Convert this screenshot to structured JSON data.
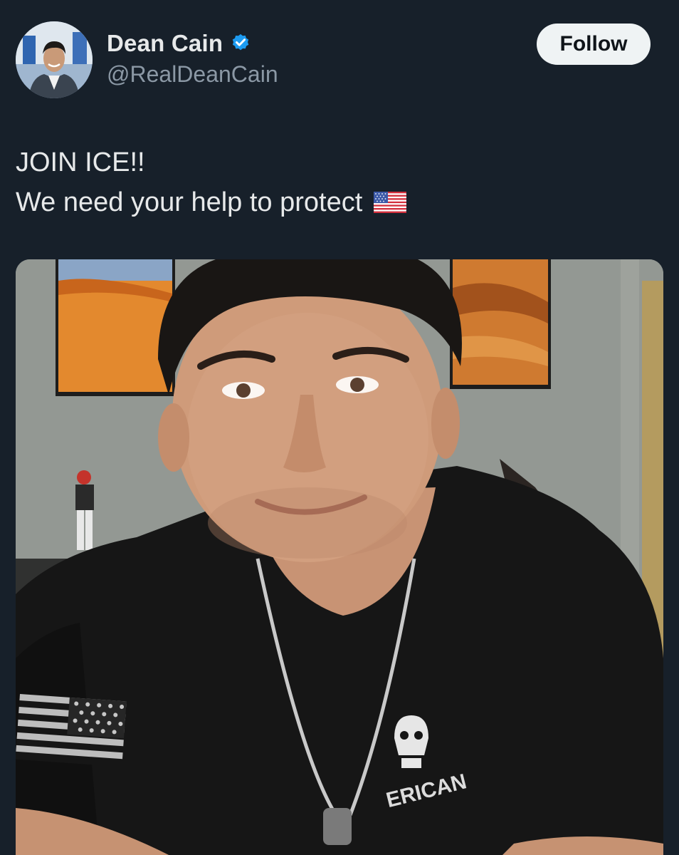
{
  "author": {
    "display_name": "Dean Cain",
    "handle": "@RealDeanCain",
    "verified": true,
    "verified_icon": "verified-badge-icon",
    "verified_color": "#1d9bf0"
  },
  "actions": {
    "follow_label": "Follow"
  },
  "tweet": {
    "line1": "JOIN ICE!!",
    "line2": "We need your help to protect",
    "emoji": "us-flag-emoji"
  },
  "media_shirt": {
    "text": "ERICAN"
  },
  "colors": {
    "background": "#17202a",
    "text_primary": "#e7e9ea",
    "text_secondary": "#8b98a5",
    "button_bg": "#eff3f4",
    "button_text": "#0f1419"
  }
}
